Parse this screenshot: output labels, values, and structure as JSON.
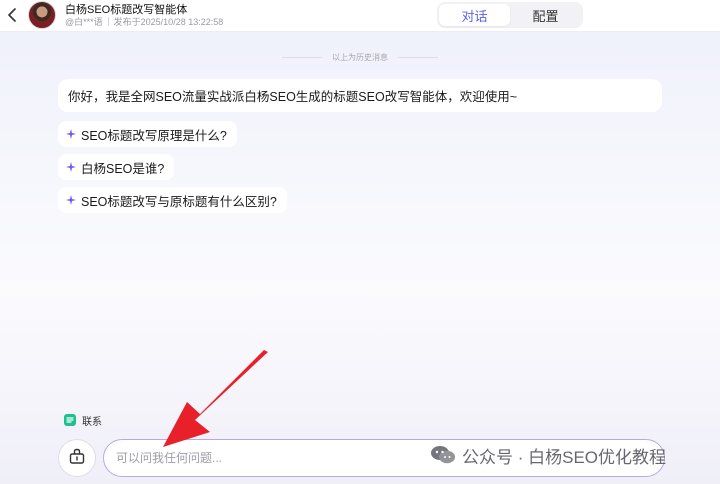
{
  "header": {
    "agent_name": "白杨SEO标题改写智能体",
    "author": "@白***语",
    "published": "发布于2025/10/28 13:22:58",
    "tabs": [
      {
        "label": "对话",
        "active": true
      },
      {
        "label": "配置",
        "active": false
      }
    ]
  },
  "chat": {
    "history_divider": "以上为历史消息",
    "welcome": "你好，我是全网SEO流量实战派白杨SEO生成的标题SEO改写智能体，欢迎使用~",
    "suggestions": [
      "SEO标题改写原理是什么?",
      "白杨SEO是谁?",
      "SEO标题改写与原标题有什么区别?"
    ]
  },
  "footer": {
    "contact_label": "联系",
    "input_placeholder": "可以问我任何问题...",
    "watermark": "公众号 · 白杨SEO优化教程"
  },
  "colors": {
    "accent": "#5b5ff0",
    "sparkle": "#6d5ce8",
    "contact": "#1fbf8f",
    "arrow": "#e8202a"
  }
}
